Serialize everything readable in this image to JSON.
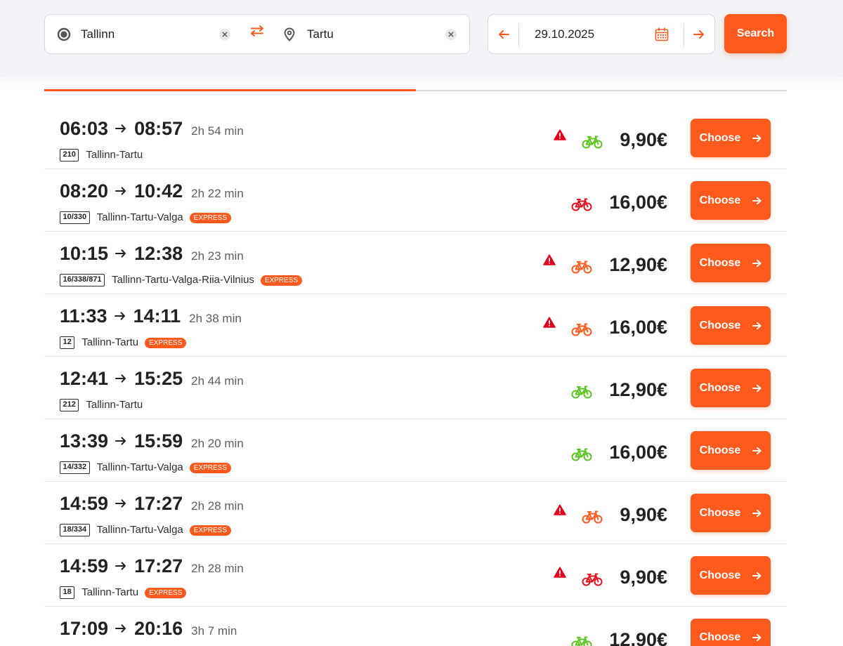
{
  "search": {
    "origin": "Tallinn",
    "destination": "Tartu",
    "date": "29.10.2025",
    "search_label": "Search"
  },
  "icons": {
    "origin": "origin-radio-icon",
    "destination": "location-pin-icon",
    "swap": "swap-arrows-icon",
    "clear": "close-icon",
    "previous_day": "arrow-left-icon",
    "next_day": "arrow-right-icon",
    "calendar": "calendar-icon",
    "warning": "warning-icon",
    "bike": "bike-icon"
  },
  "colors": {
    "accent": "#ff5a1e",
    "bike_green": "#5bc31d",
    "bike_orange": "#ff5a1e",
    "bike_red": "#e5101c",
    "warning": "#e4001b"
  },
  "loading_progress": 0.5,
  "labels": {
    "choose": "Choose"
  },
  "trips": [
    {
      "depart": "06:03",
      "arrive": "08:57",
      "duration": "2h 54 min",
      "route_number": "210",
      "route_name": "Tallinn-Tartu",
      "warning": true,
      "bike_color": "#5bc31d",
      "price": "9,90€"
    },
    {
      "depart": "08:20",
      "arrive": "10:42",
      "duration": "2h 22 min",
      "route_number": "10/330",
      "route_name": "Tallinn-Tartu-Valga",
      "badge": "EXPRESS",
      "warning": false,
      "bike_color": "#e5101c",
      "price": "16,00€"
    },
    {
      "depart": "10:15",
      "arrive": "12:38",
      "duration": "2h 23 min",
      "route_number": "16/338/871",
      "route_name": "Tallinn-Tartu-Valga-Riia-Vilnius",
      "badge": "EXPRESS",
      "warning": true,
      "bike_color": "#ff5a1e",
      "price": "12,90€"
    },
    {
      "depart": "11:33",
      "arrive": "14:11",
      "duration": "2h 38 min",
      "route_number": "12",
      "route_name": "Tallinn-Tartu",
      "badge": "EXPRESS",
      "warning": true,
      "bike_color": "#ff5a1e",
      "price": "16,00€"
    },
    {
      "depart": "12:41",
      "arrive": "15:25",
      "duration": "2h 44 min",
      "route_number": "212",
      "route_name": "Tallinn-Tartu",
      "warning": false,
      "bike_color": "#5bc31d",
      "price": "12,90€"
    },
    {
      "depart": "13:39",
      "arrive": "15:59",
      "duration": "2h 20 min",
      "route_number": "14/332",
      "route_name": "Tallinn-Tartu-Valga",
      "badge": "EXPRESS",
      "warning": false,
      "bike_color": "#5bc31d",
      "price": "16,00€"
    },
    {
      "depart": "14:59",
      "arrive": "17:27",
      "duration": "2h 28 min",
      "route_number": "18/334",
      "route_name": "Tallinn-Tartu-Valga",
      "badge": "EXPRESS",
      "warning": true,
      "bike_color": "#ff5a1e",
      "price": "9,90€"
    },
    {
      "depart": "14:59",
      "arrive": "17:27",
      "duration": "2h 28 min",
      "route_number": "18",
      "route_name": "Tallinn-Tartu",
      "badge": "EXPRESS",
      "warning": true,
      "bike_color": "#e5101c",
      "price": "9,90€"
    },
    {
      "depart": "17:09",
      "arrive": "20:16",
      "duration": "3h 7 min",
      "warning": false,
      "bike_color": "#5bc31d",
      "price": "12,90€"
    }
  ]
}
